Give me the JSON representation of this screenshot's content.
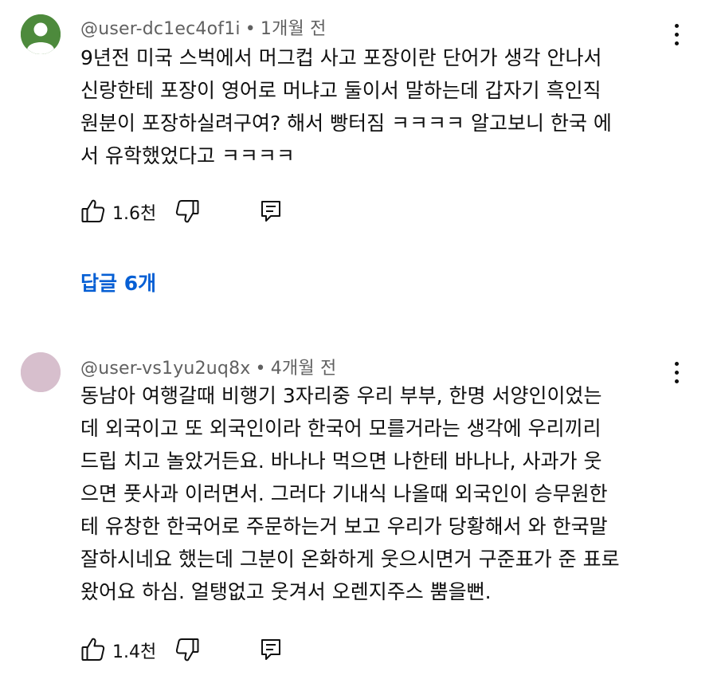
{
  "comments": [
    {
      "author": "@user-dc1ec4of1i",
      "separator": "•",
      "time": "1개월 전",
      "lines": [
        "9년전 미국 스벅에서 머그컵 사고 포장이란 단어가 생각 안나서",
        "신랑한테 포장이 영어로 머냐고 둘이서 말하는데  갑자기 흑인직",
        "원분이 포장하실려구여? 해서 빵터짐 ㅋㅋㅋㅋ 알고보니 한국 에",
        "서 유학했었다고 ㅋㅋㅋㅋ"
      ],
      "likes": "1.6천",
      "avatar_color": "#4d8a3c",
      "replies_label": "답글 6개"
    },
    {
      "author": "@user-vs1yu2uq8x",
      "separator": "•",
      "time": "4개월 전",
      "lines": [
        "동남아 여행갈때 비행기 3자리중 우리 부부, 한명 서양인이었는",
        "데 외국이고 또 외국인이라 한국어 모를거라는 생각에 우리끼리",
        "드립 치고 놀았거든요.  바나나 먹으면 나한테 바나나, 사과가 웃",
        "으면 풋사과 이러면서.  그러다 기내식 나올때 외국인이 승무원한",
        "테 유창한 한국어로  주문하는거 보고 우리가 당황해서 와 한국말",
        "잘하시네요 했는데 그분이 온화하게 웃으시면거 구준표가 준 표로",
        "왔어요 하심.  얼탱없고 웃겨서 오렌지주스 뿜을뻔."
      ],
      "likes": "1.4천",
      "avatar_color": "#d7bfcd"
    }
  ],
  "colors": {
    "accent": "#065fd4",
    "meta_text": "#606060",
    "body_text": "#0f0f0f"
  },
  "icons": [
    "person-avatar-icon",
    "more-vert-icon",
    "thumb-up-icon",
    "thumb-down-icon",
    "reply-comment-icon"
  ]
}
